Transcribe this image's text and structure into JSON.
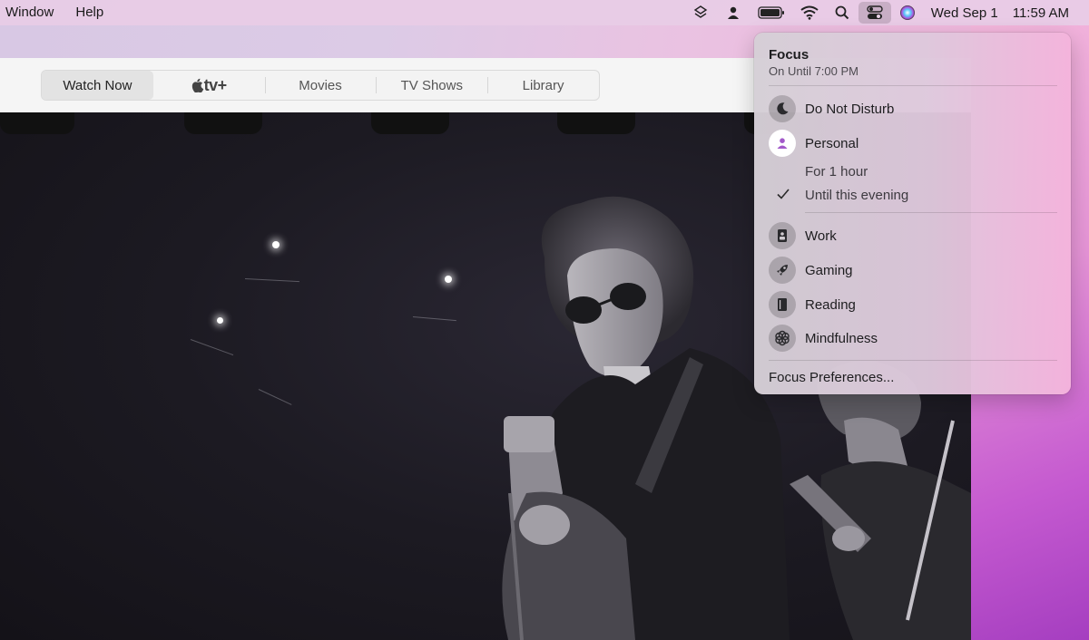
{
  "menubar": {
    "items": [
      "Window",
      "Help"
    ],
    "date": "Wed Sep 1",
    "time": "11:59 AM",
    "icons": [
      "layers-icon",
      "user-icon",
      "battery-icon",
      "wifi-icon",
      "search-icon",
      "control-center-icon",
      "siri-icon"
    ]
  },
  "tv": {
    "tabs": [
      "Watch Now",
      "tv+",
      "Movies",
      "TV Shows",
      "Library"
    ],
    "active_tab": "Watch Now"
  },
  "focus": {
    "title": "Focus",
    "subtitle": "On Until 7:00 PM",
    "modes": {
      "dnd": "Do Not Disturb",
      "personal": "Personal",
      "for_1_hour": "For 1 hour",
      "until_evening": "Until this evening",
      "work": "Work",
      "gaming": "Gaming",
      "reading": "Reading",
      "mindfulness": "Mindfulness"
    },
    "preferences": "Focus Preferences...",
    "accent_color": "#a259c9"
  }
}
